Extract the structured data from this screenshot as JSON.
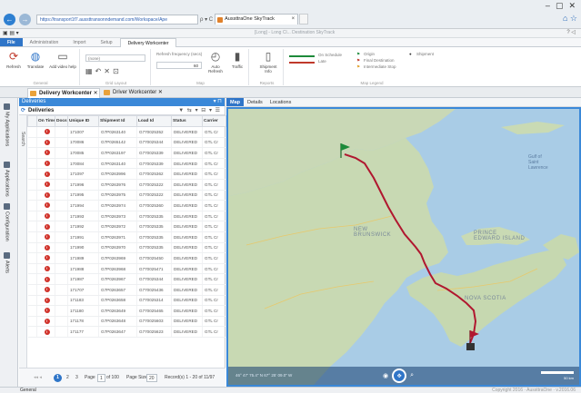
{
  "browser": {
    "url": "https://transport1f7.aussttransonndemand.com/Workspace/Ape",
    "url_tools": "ρ ▾ C",
    "tab_title": "AussttraOne SkyTrack",
    "window_controls": [
      "–",
      "▢",
      "✕"
    ]
  },
  "app": {
    "title": "[Long] - Long Cl... Destination SkyTrack",
    "title_right": "? ◁"
  },
  "ribbon_tabs": [
    "File",
    "Administration",
    "Import",
    "Setup",
    "Delivery Workcenter"
  ],
  "ribbon": {
    "general": {
      "label": "General",
      "refresh": "Refresh",
      "translate": "Translate",
      "add_video_help": "Add video help"
    },
    "grid_layout": {
      "label": "Grid Layout",
      "layout_value": "(none)"
    },
    "map": {
      "label": "Map",
      "refresh_frequency": "Refresh frequency (secs)",
      "frequency_value": "60",
      "auto_refresh": "Auto Refresh",
      "traffic": "Traffic"
    },
    "reports": {
      "label": "Reports",
      "shipment_info": "Shipment Info"
    },
    "map_legend": {
      "label": "Map Legend",
      "on_schedule": "On Schedule",
      "late": "Late",
      "origin": "Origin",
      "final_destination": "Final Destination",
      "intermediate_stop": "Intermediate Stop",
      "shipment": "Shipment"
    }
  },
  "doc_tabs": [
    {
      "label": "Delivery Workcenter",
      "active": true
    },
    {
      "label": "Driver Workcenter",
      "active": false
    }
  ],
  "left_nav": [
    "My Applications",
    "Applications",
    "Configuration",
    "Alerts"
  ],
  "deliveries": {
    "panel_title": "Deliveries",
    "grid_title": "Deliveries",
    "search_label": "Search",
    "columns": [
      "",
      "On Time",
      "Docs",
      "Unique ID",
      "Shipment Id",
      "Load Id",
      "Status",
      "Carrier"
    ],
    "rows": [
      {
        "unique": "171007",
        "ship": "G7P0263140",
        "load": "G770025352",
        "status": "DELIVERED",
        "carrier": "GTL Cr"
      },
      {
        "unique": "170086",
        "ship": "G7P0265142",
        "load": "G770025344",
        "status": "DELIVERED",
        "carrier": "GTL Cr"
      },
      {
        "unique": "170085",
        "ship": "G7P0263197",
        "load": "G770025339",
        "status": "DELIVERED",
        "carrier": "GTL Cr"
      },
      {
        "unique": "170084",
        "ship": "G7P0263140",
        "load": "G770025339",
        "status": "DELIVERED",
        "carrier": "GTL Cr"
      },
      {
        "unique": "171097",
        "ship": "G7P0263996",
        "load": "G770025362",
        "status": "DELIVERED",
        "carrier": "GTL Cr"
      },
      {
        "unique": "171996",
        "ship": "G7P0263976",
        "load": "G770025322",
        "status": "DELIVERED",
        "carrier": "GTL Cr"
      },
      {
        "unique": "171995",
        "ship": "G7P0263975",
        "load": "G770025322",
        "status": "DELIVERED",
        "carrier": "GTL Cr"
      },
      {
        "unique": "171994",
        "ship": "G7P0263974",
        "load": "G770025360",
        "status": "DELIVERED",
        "carrier": "GTL Cr"
      },
      {
        "unique": "171993",
        "ship": "G7P0263973",
        "load": "G770025335",
        "status": "DELIVERED",
        "carrier": "GTL Cr"
      },
      {
        "unique": "171992",
        "ship": "G7P0263972",
        "load": "G770025335",
        "status": "DELIVERED",
        "carrier": "GTL Cr"
      },
      {
        "unique": "171991",
        "ship": "G7P0263971",
        "load": "G770025335",
        "status": "DELIVERED",
        "carrier": "GTL Cr"
      },
      {
        "unique": "171990",
        "ship": "G7P0263970",
        "load": "G770025335",
        "status": "DELIVERED",
        "carrier": "GTL Cr"
      },
      {
        "unique": "171989",
        "ship": "G7P0263969",
        "load": "G770025450",
        "status": "DELIVERED",
        "carrier": "GTL Cr"
      },
      {
        "unique": "171988",
        "ship": "G7P0263968",
        "load": "G770025471",
        "status": "DELIVERED",
        "carrier": "GTL Cr"
      },
      {
        "unique": "171987",
        "ship": "G7P0263967",
        "load": "G770025344",
        "status": "DELIVERED",
        "carrier": "GTL Cr"
      },
      {
        "unique": "171707",
        "ship": "G7P0263657",
        "load": "G770025436",
        "status": "DELIVERED",
        "carrier": "GTL Cr"
      },
      {
        "unique": "171183",
        "ship": "G7P0263658",
        "load": "G770025314",
        "status": "DELIVERED",
        "carrier": "GTL Cr"
      },
      {
        "unique": "171180",
        "ship": "G7P0263649",
        "load": "G770025465",
        "status": "DELIVERED",
        "carrier": "GTL Cr"
      },
      {
        "unique": "171178",
        "ship": "G7P0263648",
        "load": "G770025603",
        "status": "DELIVERED",
        "carrier": "GTL Cr"
      },
      {
        "unique": "171177",
        "ship": "G7P0263647",
        "load": "G770025623",
        "status": "DELIVERED",
        "carrier": "GTL Cr"
      }
    ],
    "pager": {
      "current": "1",
      "page2": "2",
      "page3": "3",
      "page_label": "Page",
      "page_value": "1",
      "of_label": "of 100",
      "page_size_label": "Page Size",
      "page_size": "20",
      "records": "Record(s) 1 - 20 of 11/97"
    }
  },
  "map_panel": {
    "tabs": [
      "Map",
      "Details",
      "Locations"
    ],
    "labels": {
      "nb": "NEW\nBRUNSWICK",
      "pei": "PRINCE\nEDWARD ISLAND",
      "ns": "NOVA SCOTIA",
      "gulf": "Gulf of\nSaint\nLawrence"
    },
    "coords": "46° 47' 75.4\" N 67° 25' 09.0\" W",
    "scale": "50 km"
  },
  "status_bar": {
    "label": "General",
    "right": "Copyright 2016 · AussttraOne · v.2016.06"
  },
  "colors": {
    "accent": "#2f75c8",
    "route": "#b0172f",
    "on_schedule": "#1d8a3a",
    "late": "#c0392b"
  }
}
